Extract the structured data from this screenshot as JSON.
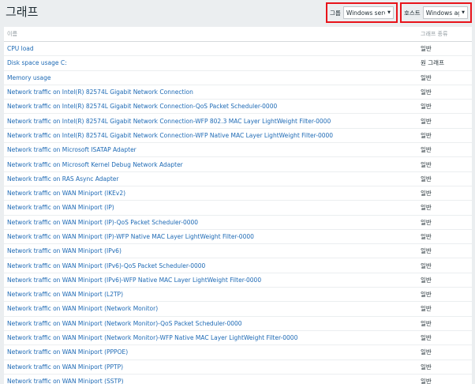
{
  "page_title": "그래프",
  "filters": {
    "group_label": "그룹",
    "group_value": "Windows server",
    "host_label": "호스트",
    "host_value": "Windows agent"
  },
  "table": {
    "headers": {
      "name": "이름",
      "type": "그래프 종류"
    },
    "rows": [
      {
        "name": "CPU load",
        "type": "일반"
      },
      {
        "name": "Disk space usage C:",
        "type": "원 그래프"
      },
      {
        "name": "Memory usage",
        "type": "일반"
      },
      {
        "name": "Network traffic on Intel(R) 82574L Gigabit Network Connection",
        "type": "일반"
      },
      {
        "name": "Network traffic on Intel(R) 82574L Gigabit Network Connection-QoS Packet Scheduler-0000",
        "type": "일반"
      },
      {
        "name": "Network traffic on Intel(R) 82574L Gigabit Network Connection-WFP 802.3 MAC Layer LightWeight Filter-0000",
        "type": "일반"
      },
      {
        "name": "Network traffic on Intel(R) 82574L Gigabit Network Connection-WFP Native MAC Layer LightWeight Filter-0000",
        "type": "일반"
      },
      {
        "name": "Network traffic on Microsoft ISATAP Adapter",
        "type": "일반"
      },
      {
        "name": "Network traffic on Microsoft Kernel Debug Network Adapter",
        "type": "일반"
      },
      {
        "name": "Network traffic on RAS Async Adapter",
        "type": "일반"
      },
      {
        "name": "Network traffic on WAN Miniport (IKEv2)",
        "type": "일반"
      },
      {
        "name": "Network traffic on WAN Miniport (IP)",
        "type": "일반"
      },
      {
        "name": "Network traffic on WAN Miniport (IP)-QoS Packet Scheduler-0000",
        "type": "일반"
      },
      {
        "name": "Network traffic on WAN Miniport (IP)-WFP Native MAC Layer LightWeight Filter-0000",
        "type": "일반"
      },
      {
        "name": "Network traffic on WAN Miniport (IPv6)",
        "type": "일반"
      },
      {
        "name": "Network traffic on WAN Miniport (IPv6)-QoS Packet Scheduler-0000",
        "type": "일반"
      },
      {
        "name": "Network traffic on WAN Miniport (IPv6)-WFP Native MAC Layer LightWeight Filter-0000",
        "type": "일반"
      },
      {
        "name": "Network traffic on WAN Miniport (L2TP)",
        "type": "일반"
      },
      {
        "name": "Network traffic on WAN Miniport (Network Monitor)",
        "type": "일반"
      },
      {
        "name": "Network traffic on WAN Miniport (Network Monitor)-QoS Packet Scheduler-0000",
        "type": "일반"
      },
      {
        "name": "Network traffic on WAN Miniport (Network Monitor)-WFP Native MAC Layer LightWeight Filter-0000",
        "type": "일반"
      },
      {
        "name": "Network traffic on WAN Miniport (PPPOE)",
        "type": "일반"
      },
      {
        "name": "Network traffic on WAN Miniport (PPTP)",
        "type": "일반"
      },
      {
        "name": "Network traffic on WAN Miniport (SSTP)",
        "type": "일반"
      }
    ]
  },
  "colors": {
    "link": "#1e6ab5",
    "highlight_border": "#e8131a",
    "background": "#ebeef0"
  }
}
